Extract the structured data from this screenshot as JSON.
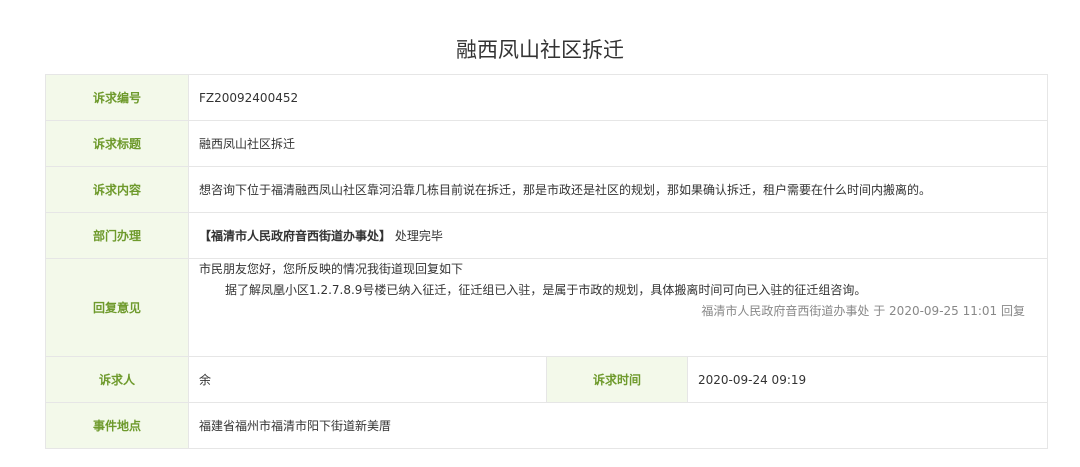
{
  "title": "融西凤山社区拆迁",
  "rows": {
    "number": {
      "label": "诉求编号",
      "value": "FZ20092400452"
    },
    "subject": {
      "label": "诉求标题",
      "value": "融西凤山社区拆迁"
    },
    "content": {
      "label": "诉求内容",
      "value": "想咨询下位于福清融西凤山社区靠河沿靠几栋目前说在拆迁，那是市政还是社区的规划，那如果确认拆迁，租户需要在什么时间内搬离的。"
    },
    "department": {
      "label": "部门办理",
      "dept": "【福清市人民政府音西街道办事处】",
      "status": "处理完毕"
    },
    "reply": {
      "label": "回复意见",
      "greeting": "市民朋友您好，您所反映的情况我街道现回复如下",
      "body": "据了解凤凰小区1.2.7.8.9号楼已纳入征迁，征迁组已入驻，是属于市政的规划，具体搬离时间可向已入驻的征迁组咨询。",
      "signature": "福清市人民政府音西街道办事处 于 2020-09-25 11:01 回复"
    },
    "requester": {
      "label": "诉求人",
      "value": "余",
      "time_label": "诉求时间",
      "time_value": "2020-09-24 09:19"
    },
    "location": {
      "label": "事件地点",
      "value": "福建省福州市福清市阳下街道新美厝"
    }
  }
}
